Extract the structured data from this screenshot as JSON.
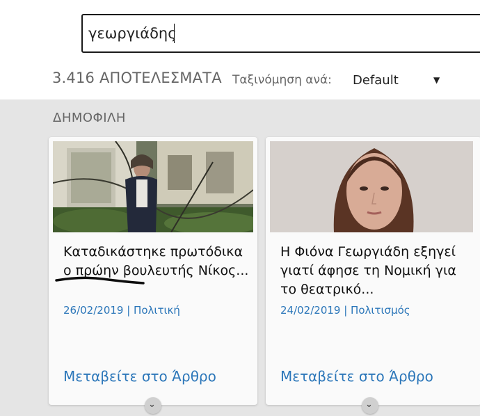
{
  "search": {
    "value": "γεωργιάδης"
  },
  "results": {
    "count_label": "3.416 ΑΠΟΤΕΛΕΣΜΑΤΑ",
    "sort_label": "Ταξινόμηση ανά:",
    "sort_value": "Default",
    "sort_arrow": "▼"
  },
  "section": {
    "title": "ΔΗΜΟΦΙΛΗ"
  },
  "cards": [
    {
      "title": "Καταδικάστηκε πρωτόδικα ο πρώην βουλευτής Νίκος...",
      "meta": "26/02/2019 | Πολιτική",
      "link": "Μεταβείτε στο Άρθρο",
      "expand_icon": "chevron-down-icon"
    },
    {
      "title": "Η Φιόνα Γεωργιάδη εξηγεί γιατί άφησε τη Νομική για το θεατρικό...",
      "meta": "24/02/2019 | Πολιτισμός",
      "link": "Μεταβείτε στο Άρθρο",
      "expand_icon": "chevron-down-icon"
    }
  ],
  "colors": {
    "link": "#2b76b9",
    "background_gray": "#e5e5e5",
    "muted_text": "#666666"
  }
}
